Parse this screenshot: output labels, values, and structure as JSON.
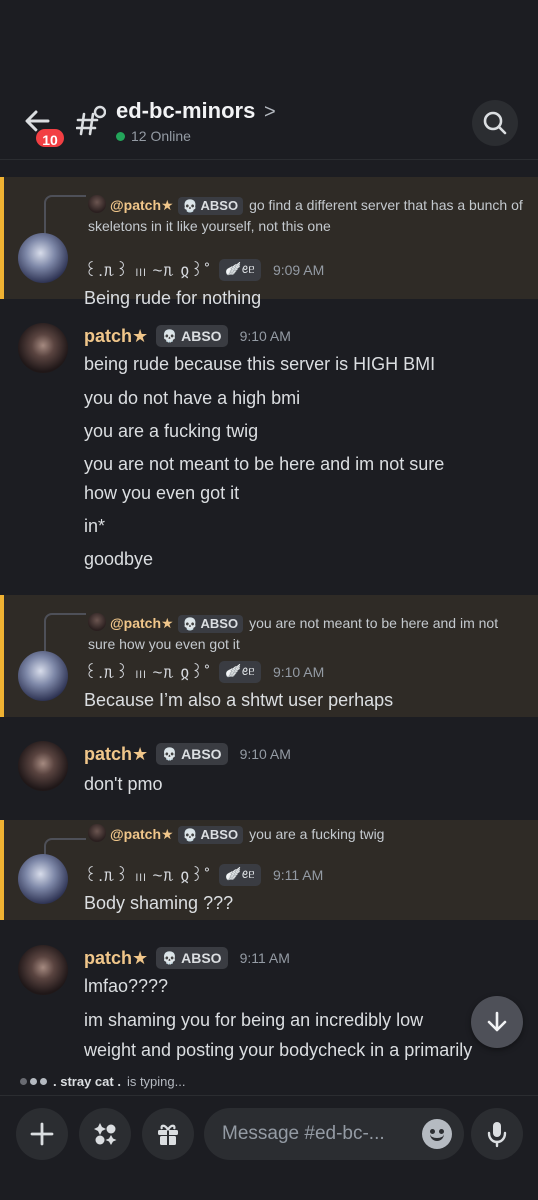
{
  "header": {
    "back_badge": "10",
    "channel_name": "ed-bc-minors",
    "chevron": ">",
    "online": "12 Online"
  },
  "messages": [
    {
      "reply_to": {
        "author": "@patch★",
        "tag": "ABSO",
        "text": "go find a different server that has a bunch of skeletons in it like yourself, not this one"
      },
      "author": "꒰.ᥰ꒱ ₗₗₗ ~ᥰ ჲ꒱˚",
      "deco": "🪽ꫀᥱ",
      "time": "9:09 AM",
      "lines": [
        "Being rude for nothing"
      ]
    },
    {
      "author": "patch★",
      "tag": "ABSO",
      "time": "9:10 AM",
      "lines": [
        "being rude because this server is HIGH BMI",
        "you do not have a high bmi",
        "you are a fucking twig",
        "you are not meant to be here and im not sure",
        "how you even got it",
        "in*",
        "goodbye"
      ]
    },
    {
      "reply_to": {
        "author": "@patch★",
        "tag": "ABSO",
        "text": "you are not meant to be here and im not sure how you even got it"
      },
      "author": "꒰.ᥰ꒱ ₗₗₗ ~ᥰ ჲ꒱˚",
      "deco": "🪽ꫀᥱ",
      "time": "9:10 AM",
      "lines": [
        "Because I’m also a shtwt user perhaps"
      ]
    },
    {
      "author": "patch★",
      "tag": "ABSO",
      "time": "9:10 AM",
      "lines": [
        "don't pmo"
      ]
    },
    {
      "reply_to": {
        "author": "@patch★",
        "tag": "ABSO",
        "text": "you are a fucking twig"
      },
      "author": "꒰.ᥰ꒱ ₗₗₗ ~ᥰ ჲ꒱˚",
      "deco": "🪽ꫀᥱ",
      "time": "9:11 AM",
      "lines": [
        "Body shaming ???"
      ]
    },
    {
      "author": "patch★",
      "tag": "ABSO",
      "time": "9:11 AM",
      "lines": [
        "lmfao????",
        "im shaming you for being an incredibly low",
        "weight and posting your bodycheck in a primarily"
      ]
    }
  ],
  "typing": {
    "user": ". stray cat .",
    "text": "is typing..."
  },
  "composer": {
    "placeholder": "Message #ed-bc-..."
  }
}
